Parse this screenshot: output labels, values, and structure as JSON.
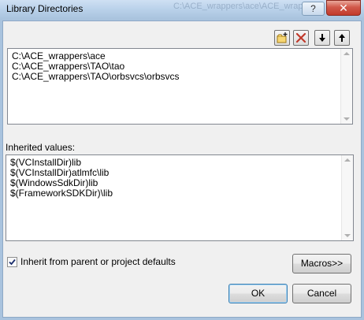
{
  "window": {
    "title": "Library Directories",
    "background_title": "C:\\ACE_wrappers\\ace\\ACE_wrappers",
    "help_label": "?",
    "close_label": "✕"
  },
  "toolbar": {
    "buttons": [
      {
        "name": "new-line-icon"
      },
      {
        "name": "delete-icon"
      },
      {
        "name": "move-down-icon"
      },
      {
        "name": "move-up-icon"
      }
    ]
  },
  "directories": [
    "C:\\ACE_wrappers\\ace",
    "C:\\ACE_wrappers\\TAO\\tao",
    "C:\\ACE_wrappers\\TAO\\orbsvcs\\orbsvcs"
  ],
  "inherited": {
    "label": "Inherited values:",
    "values": [
      "$(VCInstallDir)lib",
      "$(VCInstallDir)atlmfc\\lib",
      "$(WindowsSdkDir)lib",
      "$(FrameworkSDKDir)\\lib"
    ]
  },
  "inherit_checkbox": {
    "label": "Inherit from parent or project defaults",
    "checked": true
  },
  "buttons": {
    "macros": "Macros>>",
    "ok": "OK",
    "cancel": "Cancel"
  },
  "colors": {
    "window_frame": "#a9c3de",
    "close_button": "#c23a2b",
    "dialog_face": "#f0f0f0"
  }
}
